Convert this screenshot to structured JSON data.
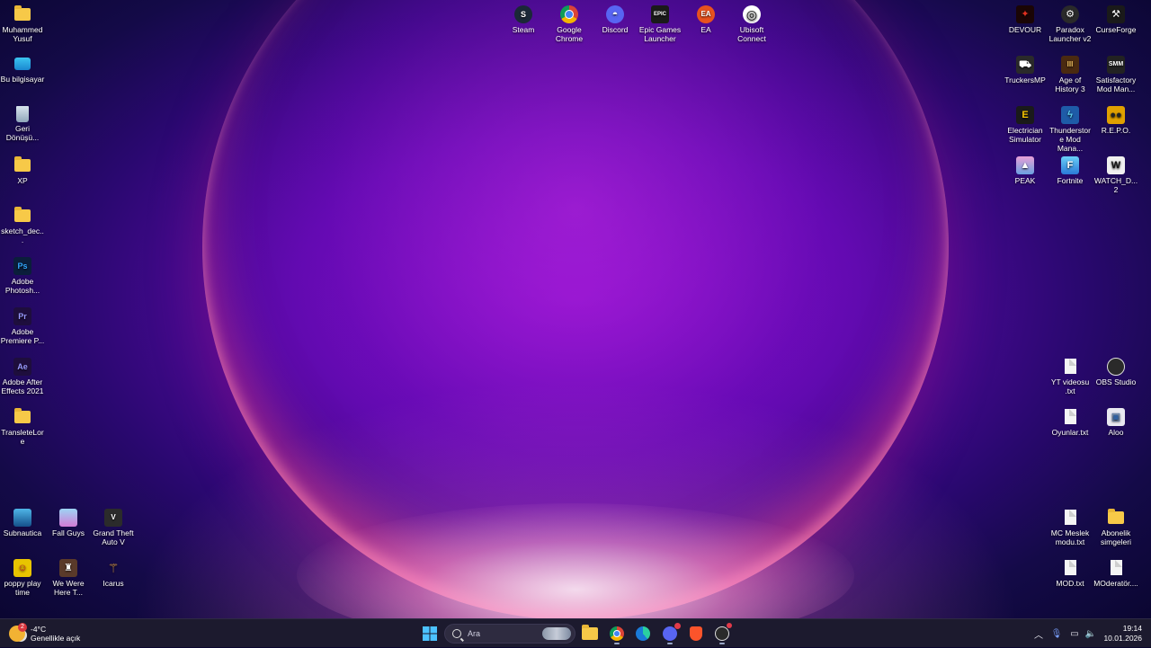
{
  "desktop": {
    "left_column": [
      {
        "name": "Muhammed Yusuf",
        "type": "folder",
        "icon": "folder-icon"
      },
      {
        "name": "Bu bilgisayar",
        "type": "pc",
        "icon": "this-pc-icon"
      },
      {
        "name": "Geri Dönüşü...",
        "type": "recycle",
        "icon": "recycle-bin-icon"
      },
      {
        "name": "XP",
        "type": "folder",
        "icon": "folder-icon"
      },
      {
        "name": "sketch_dec...",
        "type": "folder",
        "icon": "folder-icon"
      },
      {
        "name": "Adobe Photosh...",
        "type": "app",
        "icon": "photoshop-icon",
        "glyph": "Ps",
        "color": "#0b1e3b",
        "fg": "#31a8ff"
      },
      {
        "name": "Adobe Premiere P...",
        "type": "app",
        "icon": "premiere-icon",
        "glyph": "Pr",
        "color": "#1e0e3d",
        "fg": "#9999ff"
      },
      {
        "name": "Adobe After Effects 2021",
        "type": "app",
        "icon": "after-effects-icon",
        "glyph": "Ae",
        "color": "#1e0e3d",
        "fg": "#9999ff"
      },
      {
        "name": "TransleteLore",
        "type": "folder",
        "icon": "folder-icon"
      }
    ],
    "bottom_left": [
      {
        "name": "Subnautica",
        "icon": "subnautica-icon",
        "color": "#1f6fb0"
      },
      {
        "name": "Fall Guys",
        "icon": "fall-guys-icon",
        "color": "#6fb3e8"
      },
      {
        "name": "Grand Theft Auto V",
        "icon": "gta-v-icon",
        "color": "#2b2b2b"
      },
      {
        "name": "poppy play time",
        "icon": "poppy-playtime-icon",
        "color": "#e8c400"
      },
      {
        "name": "We Were Here T...",
        "icon": "we-were-here-icon",
        "color": "#5a3a2a"
      },
      {
        "name": "Icarus",
        "icon": "icarus-icon",
        "color": "#8a5a20"
      }
    ],
    "top_center": [
      {
        "name": "Steam",
        "icon": "steam-icon",
        "color": "#1b2838",
        "glyph": "S"
      },
      {
        "name": "Google Chrome",
        "icon": "chrome-icon",
        "color": "#db4437",
        "glyph": "◉"
      },
      {
        "name": "Discord",
        "icon": "discord-icon",
        "color": "#5865f2",
        "glyph": "◓"
      },
      {
        "name": "Epic Games Launcher",
        "icon": "epic-games-icon",
        "color": "#1a1a1a",
        "glyph": "EPIC"
      },
      {
        "name": "EA",
        "icon": "ea-icon",
        "color": "#e8521e",
        "glyph": "EA"
      },
      {
        "name": "Ubisoft Connect",
        "icon": "ubisoft-icon",
        "color": "#ffffff",
        "glyph": "◎"
      }
    ],
    "right_columns": [
      {
        "name": "DEVOUR",
        "icon": "devour-icon",
        "color": "#1a0505"
      },
      {
        "name": "Paradox Launcher v2",
        "icon": "paradox-icon",
        "color": "#2a2a2a"
      },
      {
        "name": "CurseForge",
        "icon": "curseforge-icon",
        "color": "#1a1a1a"
      },
      {
        "name": "TruckersMP",
        "icon": "truckersmp-icon",
        "color": "#2a2a2a"
      },
      {
        "name": "Age of History 3",
        "icon": "age-of-history-icon",
        "color": "#4a2a10"
      },
      {
        "name": "Satisfactory Mod Man...",
        "icon": "satisfactory-mod-manager-icon",
        "color": "#222222"
      },
      {
        "name": "Electrician Simulator",
        "icon": "electrician-simulator-icon",
        "color": "#1a1a1a"
      },
      {
        "name": "Thunderstore Mod Mana...",
        "icon": "thunderstore-icon",
        "color": "#1e5ba8"
      },
      {
        "name": "R.E.P.O.",
        "icon": "repo-icon",
        "color": "#e0a000"
      },
      {
        "name": "PEAK",
        "icon": "peak-icon",
        "color": "#d080c0"
      },
      {
        "name": "Fortnite",
        "icon": "fortnite-icon",
        "color": "#3aa0e8"
      },
      {
        "name": "WATCH_D... 2",
        "icon": "watch-dogs-2-icon",
        "color": "#f0f0f0"
      }
    ],
    "right_lower": [
      {
        "name": "YT videosu .txt",
        "type": "doc",
        "icon": "text-file-icon"
      },
      {
        "name": "OBS Studio",
        "type": "app",
        "icon": "obs-studio-icon"
      },
      {
        "name": "Oyunlar.txt",
        "type": "doc",
        "icon": "text-file-icon"
      },
      {
        "name": "Aloo",
        "type": "app",
        "icon": "aloo-icon"
      },
      {
        "name": "MC Meslek modu.txt",
        "type": "doc",
        "icon": "text-file-icon"
      },
      {
        "name": "Abonelik simgeleri",
        "type": "folder",
        "icon": "folder-icon"
      },
      {
        "name": "MOD.txt",
        "type": "doc",
        "icon": "text-file-icon"
      },
      {
        "name": "MOderatör....",
        "type": "doc",
        "icon": "text-file-icon"
      }
    ]
  },
  "taskbar": {
    "weather": {
      "temp": "-4°C",
      "condition": "Genellikle açık",
      "badge": "2"
    },
    "search_placeholder": "Ara",
    "pinned": [
      {
        "name": "start",
        "icon": "windows-start-icon"
      },
      {
        "name": "file-explorer",
        "icon": "file-explorer-icon"
      },
      {
        "name": "chrome",
        "icon": "chrome-icon",
        "active": true
      },
      {
        "name": "edge",
        "icon": "edge-icon"
      },
      {
        "name": "discord",
        "icon": "discord-icon",
        "active": true
      },
      {
        "name": "brave",
        "icon": "brave-icon"
      },
      {
        "name": "obs",
        "icon": "obs-studio-icon",
        "active": true
      }
    ],
    "tray": {
      "time": "19:14",
      "date": "10.01.2026"
    }
  },
  "colors": {
    "wallpaper_base": "#0a0630",
    "bloom": "#8a10c8",
    "taskbar": "#1c1a2e"
  }
}
